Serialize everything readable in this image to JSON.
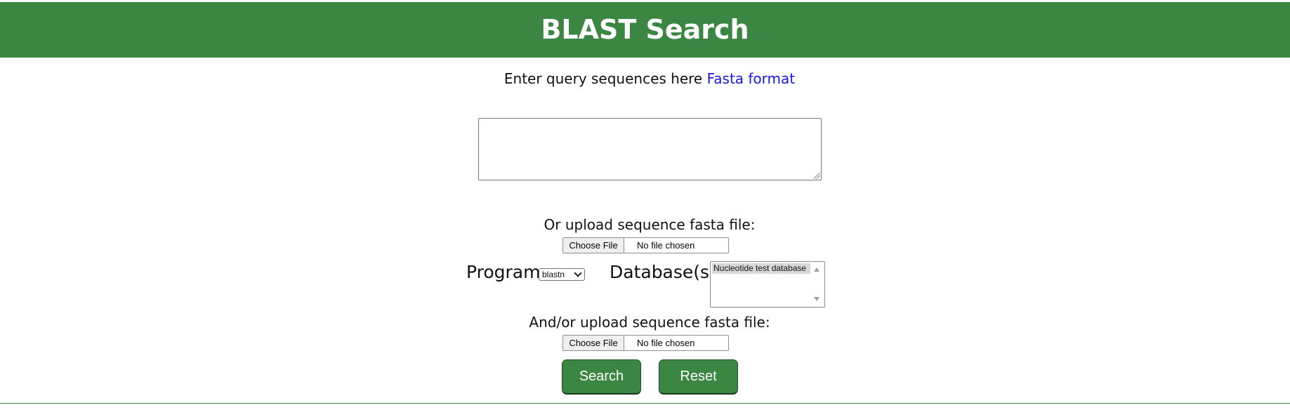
{
  "header": {
    "title": "BLAST Search"
  },
  "intro": {
    "text": "Enter query sequences here",
    "link_label": "Fasta format"
  },
  "query": {
    "value": "",
    "placeholder": ""
  },
  "upload_primary": {
    "label": "Or upload sequence fasta file:",
    "button_label": "Choose File",
    "status": "No file chosen"
  },
  "program": {
    "label": "Program",
    "selected": "blastn"
  },
  "database": {
    "label": "Database(s)",
    "options": [
      "Nucleotide test database"
    ]
  },
  "upload_secondary": {
    "label": "And/or upload sequence fasta file:",
    "button_label": "Choose File",
    "status": "No file chosen"
  },
  "actions": {
    "search_label": "Search",
    "reset_label": "Reset"
  },
  "colors": {
    "accent": "#3a8642",
    "link": "#1a16e6"
  }
}
